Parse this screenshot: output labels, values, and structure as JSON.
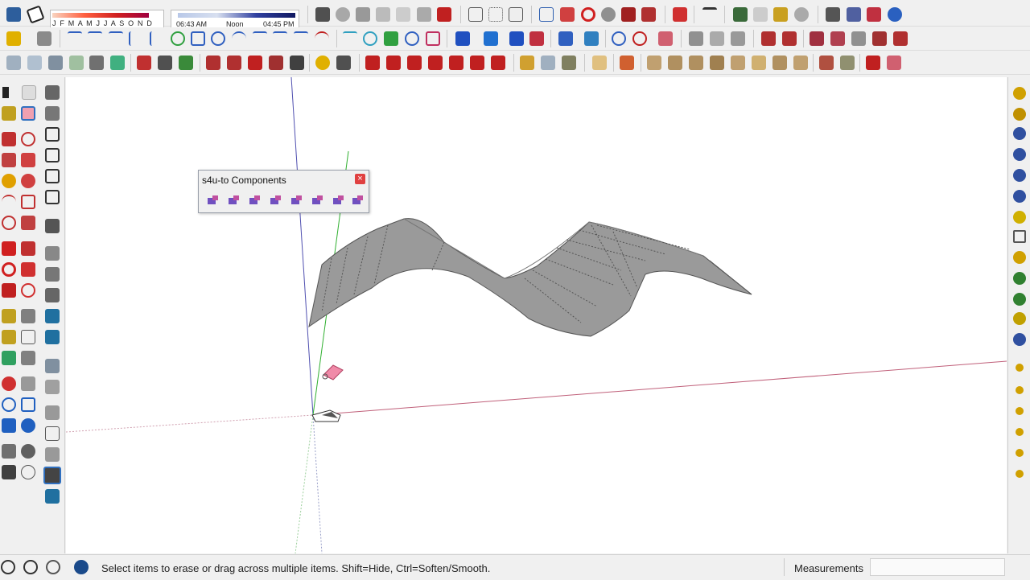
{
  "shadow_settings": {
    "months": "J F M A M J J A S O N D",
    "time_start": "06:43 AM",
    "time_mid": "Noon",
    "time_end": "04:45 PM"
  },
  "floating_panel": {
    "title": "s4u-to Components",
    "close_glyph": "×"
  },
  "status_bar": {
    "message": "Select items to erase or drag across multiple items. Shift=Hide, Ctrl=Soften/Smooth.",
    "measurements_label": "Measurements",
    "measurements_value": ""
  },
  "icons": {
    "cursor": "eraser-cursor-icon"
  },
  "colors": {
    "red_axis": "#c0607a",
    "green_axis": "#30b030",
    "blue_axis": "#5050b0",
    "surface": "#9c9c9c"
  }
}
